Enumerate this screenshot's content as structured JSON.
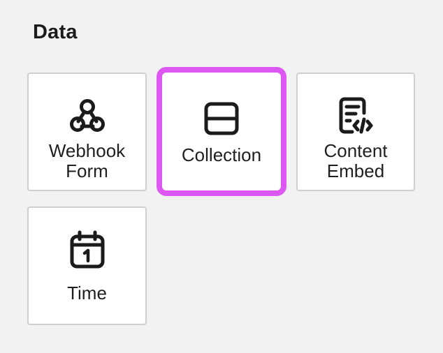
{
  "section": {
    "title": "Data"
  },
  "tiles": [
    {
      "id": "webhook-form",
      "label": "Webhook\nForm",
      "icon": "webhook-icon",
      "selected": false
    },
    {
      "id": "collection",
      "label": "Collection",
      "icon": "collection-icon",
      "selected": true
    },
    {
      "id": "content-embed",
      "label": "Content\nEmbed",
      "icon": "code-file-icon",
      "selected": false
    },
    {
      "id": "time",
      "label": "Time",
      "icon": "calendar-icon",
      "selected": false
    }
  ],
  "colors": {
    "selected_border": "#dd57f2",
    "tile_border": "#cfcfcf",
    "background": "#f2f2f2"
  }
}
